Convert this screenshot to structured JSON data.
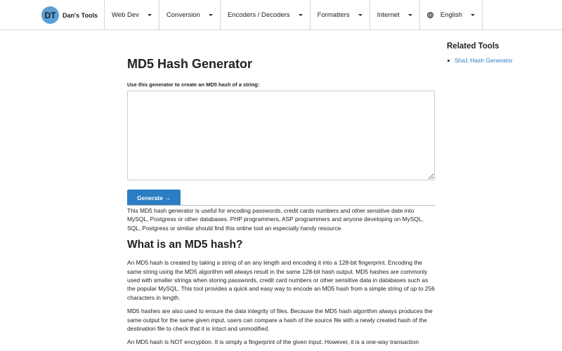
{
  "navbar": {
    "brand_initials": "DT",
    "brand_name": "Dan's Tools",
    "items": [
      {
        "label": "Web Dev"
      },
      {
        "label": "Conversion"
      },
      {
        "label": "Encoders / Decoders"
      },
      {
        "label": "Formatters"
      },
      {
        "label": "Internet"
      },
      {
        "label": "English",
        "icon": "globe-icon"
      }
    ]
  },
  "main": {
    "title": "MD5 Hash Generator",
    "input_label": "Use this generator to create an MD5 hash of a string:",
    "input_value": "",
    "generate_label": "Generate →",
    "intro": "This MD5 hash generator is useful for encoding passwords, credit cards numbers and other sensitive date into MySQL, Postgress or other databases. PHP programmers, ASP programmers and anyone developing on MySQL, SQL, Postgress or similar should find this online tool an especially handy resource.",
    "section_title": "What is an MD5 hash?",
    "paragraphs": [
      "An MD5 hash is created by taking a string of an any length and encoding it into a 128-bit fingerprint. Encoding the same string using the MD5 algorithm will always result in the same 128-bit hash output. MD5 hashes are commonly used with smaller strings when storing passwords, credit card numbers or other sensitive data in databases such as the popular MySQL. This tool provides a quick and easy way to encode an MD5 hash from a simple string of up to 256 characters in length.",
      "MD5 hashes are also used to ensure the data integrity of files. Because the MD5 hash algorithm always produces the same output for the same given input, users can compare a hash of the source file with a newly created hash of the destination file to check that it is intact and unmodified.",
      "An MD5 hash is NOT encryption. It is simply a fingerprint of the given input. However, it is a one-way transaction"
    ]
  },
  "sidebar": {
    "title": "Related Tools",
    "links": [
      {
        "label": "Sha1 Hash Generator"
      }
    ]
  },
  "colors": {
    "accent": "#2b7ec3",
    "logo": "#5a9fd6",
    "border": "#d4d4d4"
  }
}
